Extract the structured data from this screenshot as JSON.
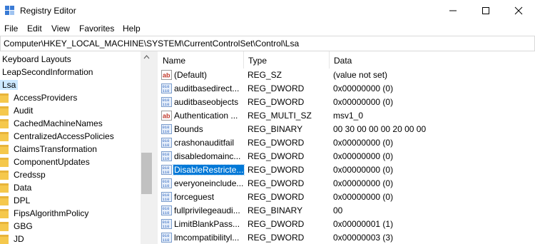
{
  "window": {
    "title": "Registry Editor"
  },
  "menu": [
    "File",
    "Edit",
    "View",
    "Favorites",
    "Help"
  ],
  "address": "Computer\\HKEY_LOCAL_MACHINE\\SYSTEM\\CurrentControlSet\\Control\\Lsa",
  "tree": {
    "top_items": [
      "Keyboard Layouts",
      "LeapSecondInformation"
    ],
    "selected": "Lsa",
    "children": [
      "AccessProviders",
      "Audit",
      "CachedMachineNames",
      "CentralizedAccessPolicies",
      "ClaimsTransformation",
      "ComponentUpdates",
      "Credssp",
      "Data",
      "DPL",
      "FipsAlgorithmPolicy",
      "GBG",
      "JD"
    ]
  },
  "columns": {
    "name": "Name",
    "type": "Type",
    "data": "Data"
  },
  "values": [
    {
      "name": "(Default)",
      "type": "REG_SZ",
      "data": "(value not set)",
      "icon": "string-value-icon"
    },
    {
      "name": "auditbasedirect...",
      "type": "REG_DWORD",
      "data": "0x00000000 (0)",
      "icon": "binary-value-icon"
    },
    {
      "name": "auditbaseobjects",
      "type": "REG_DWORD",
      "data": "0x00000000 (0)",
      "icon": "binary-value-icon"
    },
    {
      "name": "Authentication ...",
      "type": "REG_MULTI_SZ",
      "data": "msv1_0",
      "icon": "string-value-icon"
    },
    {
      "name": "Bounds",
      "type": "REG_BINARY",
      "data": "00 30 00 00 00 20 00 00",
      "icon": "binary-value-icon"
    },
    {
      "name": "crashonauditfail",
      "type": "REG_DWORD",
      "data": "0x00000000 (0)",
      "icon": "binary-value-icon"
    },
    {
      "name": "disabledomainc...",
      "type": "REG_DWORD",
      "data": "0x00000000 (0)",
      "icon": "binary-value-icon"
    },
    {
      "name": "DisableRestricte...",
      "type": "REG_DWORD",
      "data": "0x00000000 (0)",
      "icon": "binary-value-icon"
    },
    {
      "name": "everyoneinclude...",
      "type": "REG_DWORD",
      "data": "0x00000000 (0)",
      "icon": "binary-value-icon"
    },
    {
      "name": "forceguest",
      "type": "REG_DWORD",
      "data": "0x00000000 (0)",
      "icon": "binary-value-icon"
    },
    {
      "name": "fullprivilegeaudi...",
      "type": "REG_BINARY",
      "data": "00",
      "icon": "binary-value-icon"
    },
    {
      "name": "LimitBlankPass...",
      "type": "REG_DWORD",
      "data": "0x00000001 (1)",
      "icon": "binary-value-icon"
    },
    {
      "name": "lmcompatibilityl...",
      "type": "REG_DWORD",
      "data": "0x00000003 (3)",
      "icon": "binary-value-icon"
    }
  ],
  "selected_value": "DisableRestricte...",
  "colors": {
    "selection": "#0078d7",
    "tree_selection": "#cce8ff",
    "folder": "#f5c84c",
    "string_icon": "#c0392b",
    "binary_icon": "#2a62bc"
  }
}
